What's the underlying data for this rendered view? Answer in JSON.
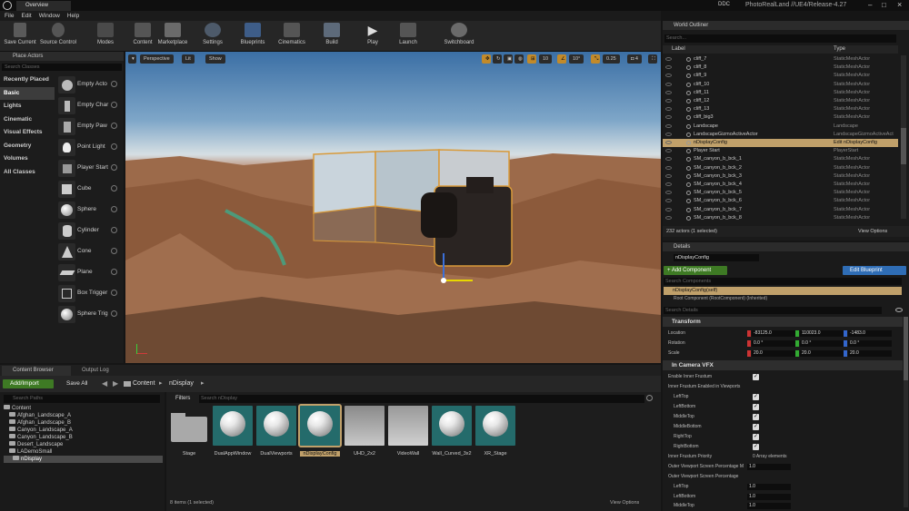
{
  "title_bar": {
    "tab": "Overview",
    "project": "PhotoRealLand //UE4/Release-4.27",
    "ddc": "DDC"
  },
  "menu": [
    "File",
    "Edit",
    "Window",
    "Help"
  ],
  "toolbar": [
    "Save Current",
    "Source Control",
    "Modes",
    "Content",
    "Marketplace",
    "Settings",
    "Blueprints",
    "Cinematics",
    "Build",
    "Play",
    "Launch",
    "Switchboard"
  ],
  "place_actors": {
    "tab": "Place Actors",
    "search_placeholder": "Search Classes",
    "categories": [
      "Recently Placed",
      "Basic",
      "Lights",
      "Cinematic",
      "Visual Effects",
      "Geometry",
      "Volumes",
      "All Classes"
    ],
    "actors": [
      "Empty Acto",
      "Empty Char",
      "Empty Paw",
      "Point Light",
      "Player Start",
      "Cube",
      "Sphere",
      "Cylinder",
      "Cone",
      "Plane",
      "Box Trigger",
      "Sphere Trig"
    ]
  },
  "viewport": {
    "perspective": "Perspective",
    "lit": "Lit",
    "show": "Show",
    "grid": "10",
    "rotation": "10°",
    "scale": "0.25",
    "camera_speed": "4"
  },
  "outliner": {
    "tab": "World Outliner",
    "search_placeholder": "Search...",
    "col_label": "Label",
    "col_type": "Type",
    "rows": [
      {
        "label": "cliff_7",
        "type": "StaticMeshActor"
      },
      {
        "label": "cliff_8",
        "type": "StaticMeshActor"
      },
      {
        "label": "cliff_9",
        "type": "StaticMeshActor"
      },
      {
        "label": "cliff_10",
        "type": "StaticMeshActor"
      },
      {
        "label": "cliff_11",
        "type": "StaticMeshActor"
      },
      {
        "label": "cliff_12",
        "type": "StaticMeshActor"
      },
      {
        "label": "cliff_13",
        "type": "StaticMeshActor"
      },
      {
        "label": "cliff_big3",
        "type": "StaticMeshActor"
      },
      {
        "label": "Landscape",
        "type": "Landscape"
      },
      {
        "label": "LandscapeGizmoActiveActor",
        "type": "LandscapeGizmoActiveAct"
      },
      {
        "label": "nDisplayConfig",
        "type": "Edit nDisplayConfig"
      },
      {
        "label": "Player Start",
        "type": "PlayerStart"
      },
      {
        "label": "SM_canyon_b_bck_1",
        "type": "StaticMeshActor"
      },
      {
        "label": "SM_canyon_b_bck_2",
        "type": "StaticMeshActor"
      },
      {
        "label": "SM_canyon_b_bck_3",
        "type": "StaticMeshActor"
      },
      {
        "label": "SM_canyon_b_bck_4",
        "type": "StaticMeshActor"
      },
      {
        "label": "SM_canyon_b_bck_5",
        "type": "StaticMeshActor"
      },
      {
        "label": "SM_canyon_b_bck_6",
        "type": "StaticMeshActor"
      },
      {
        "label": "SM_canyon_b_bck_7",
        "type": "StaticMeshActor"
      },
      {
        "label": "SM_canyon_b_bck_8",
        "type": "StaticMeshActor"
      }
    ],
    "selected_row": "nDisplayConfig",
    "count": "232 actors (1 selected)",
    "view_options": "View Options"
  },
  "details": {
    "tab": "Details",
    "name": "nDisplayConfig",
    "add_component": "+ Add Component",
    "edit_blueprint": "Edit Blueprint",
    "search_components": "Search Components",
    "self_component": "nDisplayConfig(self)",
    "root_component": "Root Component (RootComponent) (Inherited)",
    "search_details": "Search Details",
    "transform": "Transform",
    "location": {
      "label": "Location",
      "x": "-83125.0",
      "y": "110023.0",
      "z": "-1483.0"
    },
    "rotation": {
      "label": "Rotation",
      "x": "0.0 °",
      "y": "0.0 °",
      "z": "0.0 °"
    },
    "scale": {
      "label": "Scale",
      "x": "20.0",
      "y": "20.0",
      "z": "20.0"
    },
    "in_camera_vfx": "In Camera VFX",
    "enable_inner_frustum": "Enable Inner Frustum",
    "inner_frustum_enabled": "Inner Frustum Enabled in Viewports",
    "viewports": [
      "LeftTop",
      "LeftBottom",
      "MiddleTop",
      "MiddleBottom",
      "RightTop",
      "RightBottom"
    ],
    "inner_frustum_priority": "Inner Frustum Priority",
    "priority_value": "0 Array elements",
    "outer_pct": "Outer Viewport Screen Percentage M",
    "outer_pct_value": "1.0",
    "outer_pct2": "Outer Viewport Screen Percentage",
    "outer_rows": [
      {
        "label": "LeftTop",
        "value": "1.0"
      },
      {
        "label": "LeftBottom",
        "value": "1.0"
      },
      {
        "label": "MiddleTop",
        "value": "1.0"
      }
    ]
  },
  "content_browser": {
    "tab": "Content Browser",
    "tab2": "Output Log",
    "add_import": "Add/Import",
    "save_all": "Save All",
    "crumbs": [
      "Content",
      "nDisplay"
    ],
    "search_paths": "Search Paths",
    "filters": "Filters",
    "search_assets": "Search nDisplay",
    "tree": [
      "Content",
      "Afghan_Landscape_A",
      "Afghan_Landscape_B",
      "Canyon_Landscape_A",
      "Canyon_Landscape_B",
      "Desert_Landscape",
      "LADemoSmall",
      "nDisplay"
    ],
    "assets": [
      "Stage",
      "DualAppWindow",
      "DualViewports",
      "nDisplayConfig",
      "UHD_2x2",
      "VideoWall",
      "Wall_Curved_3x2",
      "XR_Stage"
    ],
    "item_count": "8 items (1 selected)",
    "view_options": "View Options"
  },
  "colors": {
    "accent": "#c0a06a",
    "green": "#6aa73a",
    "blue": "#2f6db5",
    "selection_orange": "#c28a2a"
  }
}
